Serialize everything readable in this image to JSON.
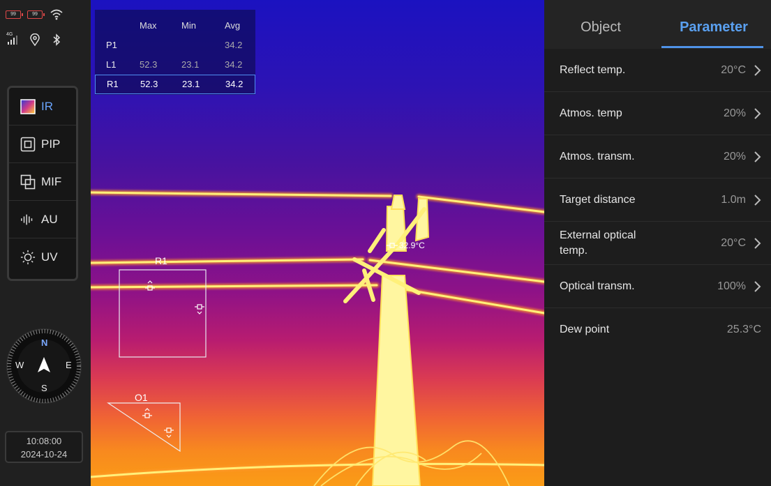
{
  "status": {
    "battery1": "99",
    "battery2": "99",
    "signal_label": "4G"
  },
  "modes": [
    {
      "label": "IR",
      "icon": "ir-gradient-icon",
      "active": true
    },
    {
      "label": "PIP",
      "icon": "pip-icon",
      "active": false
    },
    {
      "label": "MIF",
      "icon": "mif-icon",
      "active": false
    },
    {
      "label": "AU",
      "icon": "audio-wave-icon",
      "active": false
    },
    {
      "label": "UV",
      "icon": "sun-icon",
      "active": false
    }
  ],
  "compass": {
    "n": "N",
    "s": "S",
    "e": "E",
    "w": "W"
  },
  "datetime": {
    "time": "10:08:00",
    "date": "2024-10-24"
  },
  "measurement_table": {
    "headers": [
      "",
      "Max",
      "Min",
      "Avg"
    ],
    "rows": [
      {
        "name": "P1",
        "max": "",
        "min": "",
        "avg": "34.2"
      },
      {
        "name": "L1",
        "max": "52.3",
        "min": "23.1",
        "avg": "34.2"
      },
      {
        "name": "R1",
        "max": "52.3",
        "min": "23.1",
        "avg": "34.2"
      }
    ]
  },
  "overlays": {
    "region_label": "R1",
    "triangle_label": "O1",
    "spot_reading": "32.9°C"
  },
  "tabs": [
    {
      "label": "Object",
      "active": false
    },
    {
      "label": "Parameter",
      "active": true
    }
  ],
  "parameters": [
    {
      "label": "Reflect temp.",
      "value": "20°C",
      "arrow": true
    },
    {
      "label": "Atmos. temp",
      "value": "20%",
      "arrow": true
    },
    {
      "label": "Atmos. transm.",
      "value": "20%",
      "arrow": true
    },
    {
      "label": "Target distance",
      "value": "1.0m",
      "arrow": true
    },
    {
      "label": "External optical temp.",
      "value": "20°C",
      "arrow": true
    },
    {
      "label": "Optical transm.",
      "value": "100%",
      "arrow": true
    },
    {
      "label": "Dew point",
      "value": "25.3°C",
      "arrow": false
    }
  ],
  "colors": {
    "accent": "#4f93e8",
    "panel_bg": "#1d1d1d",
    "sidebar_bg": "#202020",
    "hot_wire": "#fff06a",
    "battery_red": "#e04848"
  }
}
